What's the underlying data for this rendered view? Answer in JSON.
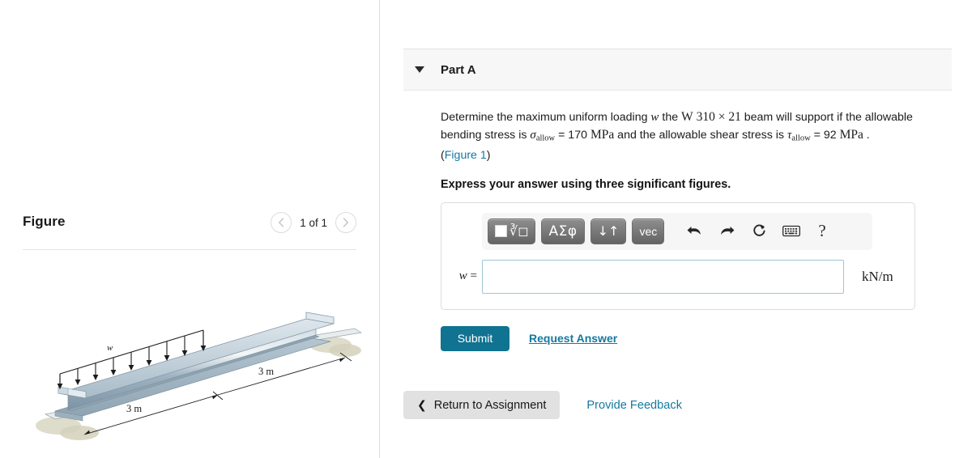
{
  "figure_pane": {
    "title": "Figure",
    "nav": {
      "prev_icon": "chevron-left-icon",
      "counter": "1 of 1",
      "next_icon": "chevron-right-icon"
    },
    "diagram": {
      "alt": "Isometric W-shape steel I-beam on two supports with uniform distributed load on left half",
      "load_label": "w",
      "dim_left": "3 m",
      "dim_right": "3 m"
    }
  },
  "question": {
    "part_label": "Part A",
    "collapse_icon": "caret-down-icon",
    "prompt": {
      "seg1": "Determine the maximum uniform loading ",
      "var_w": "w",
      "seg2": " the ",
      "beam_w": "W",
      "beam_310": "310",
      "beam_times": "×",
      "beam_21": "21",
      "seg3": " beam will support if the allowable bending stress is ",
      "sigma": "σ",
      "sigma_sub": "allow",
      "seg4": " = 170 ",
      "mpa1": "MPa",
      "seg5": " and the allowable shear stress is ",
      "tau": "τ",
      "tau_sub": "allow",
      "seg6": " = 92 ",
      "mpa2": "MPa",
      "seg7": " .",
      "figure_link_open": "(",
      "figure_link": "Figure 1",
      "figure_link_close": ")"
    },
    "instruction": "Express your answer using three significant figures.",
    "toolbar": {
      "template_button": "template-sqrt-icon",
      "greek_button": "ΑΣφ",
      "arrows_button": "↓↑",
      "vec_button": "vec",
      "undo_icon": "undo-arrow-icon",
      "redo_icon": "redo-arrow-icon",
      "reset_icon": "reset-circular-arrow-icon",
      "keyboard_icon": "keyboard-icon",
      "help_label": "?"
    },
    "answer": {
      "variable": "w",
      "equals": "=",
      "value": "",
      "placeholder": "",
      "units": "kN/m"
    },
    "submit_label": "Submit",
    "request_answer_label": "Request Answer"
  },
  "footer": {
    "return_icon": "chevron-left-icon",
    "return_label": "Return to Assignment",
    "feedback_label": "Provide Feedback"
  },
  "colors": {
    "accent_link": "#1579a0",
    "submit_bg": "#0f7391",
    "panel_header_bg": "#f7f7f7",
    "input_border": "#9ec6d8",
    "return_bg": "#e1e1e1"
  }
}
